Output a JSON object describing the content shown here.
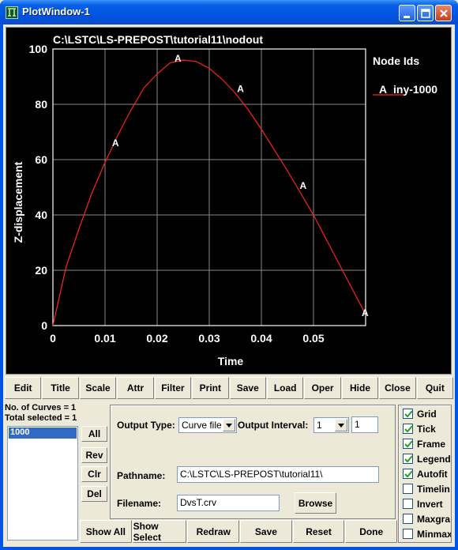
{
  "window": {
    "title": "PlotWindow-1"
  },
  "chart_data": {
    "type": "line",
    "title": "C:\\LSTC\\LS-PREPOST\\tutorial11\\nodout",
    "xlabel": "Time",
    "ylabel": "Z-displacement",
    "xlim": [
      0,
      0.06
    ],
    "ylim": [
      0,
      100
    ],
    "xticks": [
      "0",
      "0.01",
      "0.02",
      "0.03",
      "0.04",
      "0.05"
    ],
    "yticks": [
      "0",
      "20",
      "40",
      "60",
      "80",
      "100"
    ],
    "grid": true,
    "legend": {
      "title": "Node Ids",
      "placement": "top-right"
    },
    "series": [
      {
        "name": "iny-1000",
        "marker": "A",
        "color": "#ff2020",
        "x": [
          0,
          0.0025,
          0.005,
          0.0075,
          0.01,
          0.0125,
          0.015,
          0.0175,
          0.02,
          0.0225,
          0.025,
          0.0275,
          0.03,
          0.0325,
          0.035,
          0.0375,
          0.04,
          0.0425,
          0.045,
          0.0475,
          0.05,
          0.0525,
          0.055,
          0.0575,
          0.06
        ],
        "values": [
          0,
          21,
          35,
          48,
          59,
          69,
          78,
          86,
          91,
          95,
          96,
          95.5,
          93,
          89,
          84,
          78,
          71,
          63.5,
          56,
          48,
          40,
          31,
          22,
          13,
          4
        ],
        "marker_points": [
          [
            0.0121,
            65.5
          ],
          [
            0.0241,
            96
          ],
          [
            0.0361,
            85
          ],
          [
            0.0481,
            50
          ],
          [
            0.06,
            4
          ]
        ]
      }
    ]
  },
  "buttons": {
    "edit": "Edit",
    "title": "Title",
    "scale": "Scale",
    "attr": "Attr",
    "filter": "Filter",
    "print": "Print",
    "save": "Save",
    "load": "Load",
    "oper": "Oper",
    "hide": "Hide",
    "close": "Close",
    "quit": "Quit"
  },
  "curves": {
    "count_text": "No. of Curves = 1",
    "selected_text": "Total selected = 1",
    "items": [
      "1000"
    ],
    "all": "All",
    "rev": "Rev",
    "clr": "Clr",
    "del": "Del"
  },
  "output": {
    "type_label": "Output Type:",
    "type_value": "Curve file",
    "interval_label": "Output Interval:",
    "interval_value": "1",
    "interval_field": "1",
    "pathname_label": "Pathname:",
    "pathname_value": "C:\\LSTC\\LS-PREPOST\\tutorial11\\",
    "filename_label": "Filename:",
    "filename_value": "DvsT.crv",
    "browse": "Browse"
  },
  "bottom": {
    "show_all": "Show All",
    "show_select": "Show Select",
    "redraw": "Redraw",
    "save": "Save",
    "reset": "Reset",
    "done": "Done"
  },
  "options": [
    {
      "label": "Grid",
      "checked": true
    },
    {
      "label": "Tick",
      "checked": true
    },
    {
      "label": "Frame",
      "checked": true
    },
    {
      "label": "Legend",
      "checked": true
    },
    {
      "label": "Autofit",
      "checked": true
    },
    {
      "label": "Timelin",
      "checked": false
    },
    {
      "label": "Invert",
      "checked": false
    },
    {
      "label": "Maxgra",
      "checked": false
    },
    {
      "label": "Minmax",
      "checked": false
    }
  ]
}
